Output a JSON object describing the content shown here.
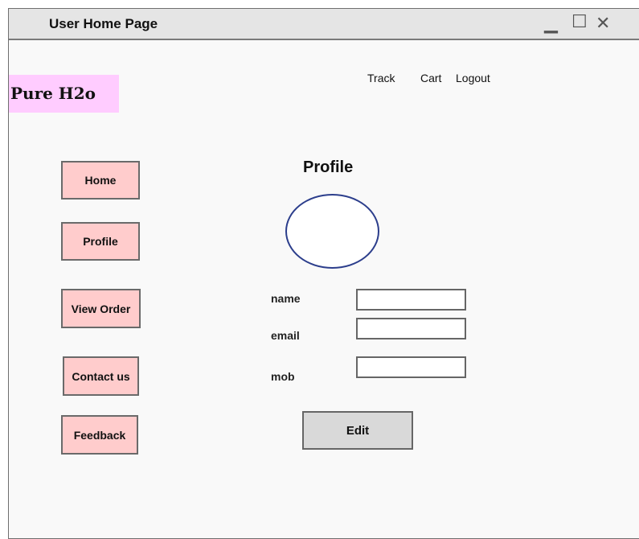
{
  "window": {
    "title": "User Home Page"
  },
  "header": {
    "logo": "Pure H2o",
    "links": {
      "track": "Track",
      "cart": "Cart",
      "logout": "Logout"
    }
  },
  "sidebar": {
    "home": "Home",
    "profile": "Profile",
    "view_order": "View Order",
    "contact": "Contact us",
    "feedback": "Feedback"
  },
  "main": {
    "heading": "Profile",
    "fields": {
      "name_label": "name",
      "email_label": "email",
      "mob_label": "mob",
      "name_value": "",
      "email_value": "",
      "mob_value": ""
    },
    "edit_label": "Edit"
  }
}
